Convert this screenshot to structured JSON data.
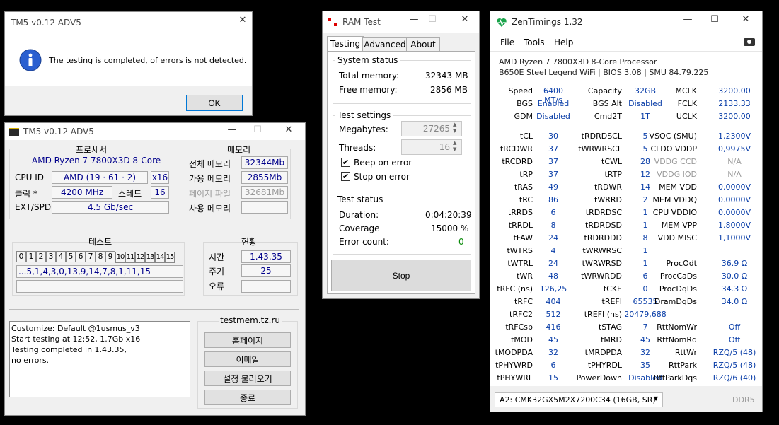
{
  "dialog": {
    "title": "TM5 v0.12 ADV5",
    "message": "The testing is completed, of errors is not detected.",
    "ok_label": "OK",
    "close": "✕"
  },
  "tm5": {
    "title": "TM5 v0.12 ADV5",
    "processor_header": "프로세서",
    "cpu_name": "AMD Ryzen 7 7800X3D 8-Core",
    "cpu_id_label": "CPU ID",
    "cpu_id_value": "AMD  (19 · 61 · 2)",
    "threads_x": "x16",
    "clock_label": "클럭 *",
    "clock_value": "4200 MHz",
    "threads_label": "스레드",
    "threads_value": "16",
    "ext_label": "EXT/SPD",
    "ext_value": "4.5 Gb/sec",
    "memory_header": "메모리",
    "mem_total_label": "전체 메모리",
    "mem_total_value": "32344Mb",
    "mem_avail_label": "가용 메모리",
    "mem_avail_value": "2855Mb",
    "mem_page_label": "페이지 파일",
    "mem_page_value": "32681Mb",
    "mem_used_label": "사용 메모리",
    "mem_used_value": "",
    "test_header": "테스트",
    "test_cells": [
      "0",
      "1",
      "2",
      "3",
      "4",
      "5",
      "6",
      "7",
      "8",
      "9",
      "10",
      "11",
      "12",
      "13",
      "14",
      "15"
    ],
    "test_sequence": "...5,1,4,3,0,13,9,14,7,8,1,11,15",
    "status_header": "현황",
    "time_label": "시간",
    "time_value": "1.43.35",
    "cycle_label": "주기",
    "cycle_value": "25",
    "error_label": "오류",
    "error_value": "",
    "site": "testmem.tz.ru",
    "log": [
      "Customize: Default @1usmus_v3",
      "Start testing at 12:52, 1.7Gb x16",
      "Testing completed in 1.43.35,",
      "no errors."
    ],
    "btn_home": "홈페이지",
    "btn_email": "이메일",
    "btn_load": "설정 불러오기",
    "btn_exit": "종료"
  },
  "ramtest": {
    "title": "RAM Test",
    "tabs": [
      "Testing",
      "Advanced",
      "About"
    ],
    "system_status": "System status",
    "total_mem_label": "Total memory:",
    "total_mem_value": "32343 MB",
    "free_mem_label": "Free memory:",
    "free_mem_value": "2856 MB",
    "test_settings": "Test settings",
    "megabytes_label": "Megabytes:",
    "megabytes_value": "27265",
    "threads_label": "Threads:",
    "threads_value": "16",
    "beep_label": "Beep on error",
    "stop_label": "Stop on error",
    "test_status": "Test status",
    "duration_label": "Duration:",
    "duration_value": "0:04:20:39",
    "coverage_label": "Coverage",
    "coverage_value": "15000 %",
    "errors_label": "Error count:",
    "errors_value": "0",
    "stop_button": "Stop"
  },
  "zen": {
    "title": "ZenTimings 1.32",
    "menu": [
      "File",
      "Tools",
      "Help"
    ],
    "cpu": "AMD Ryzen 7 7800X3D 8-Core Processor",
    "board": "B650E Steel Legend WiFi | BIOS 3.08 | SMU 84.79.225",
    "top": [
      [
        [
          "Speed",
          "6400 MT/s"
        ],
        [
          "Capacity",
          "32GB"
        ],
        [
          "MCLK",
          "3200.00"
        ]
      ],
      [
        [
          "BGS",
          "Enabled"
        ],
        [
          "BGS Alt",
          "Disabled"
        ],
        [
          "FCLK",
          "2133.33"
        ]
      ],
      [
        [
          "GDM",
          "Disabled"
        ],
        [
          "Cmd2T",
          "1T"
        ],
        [
          "UCLK",
          "3200.00"
        ]
      ]
    ],
    "rows": [
      [
        [
          "tCL",
          "30"
        ],
        [
          "tRDRDSCL",
          "5"
        ],
        [
          "VSOC (SMU)",
          "1,2300V"
        ]
      ],
      [
        [
          "tRCDWR",
          "37"
        ],
        [
          "tWRWRSCL",
          "5"
        ],
        [
          "CLDO VDDP",
          "0,9975V"
        ]
      ],
      [
        [
          "tRCDRD",
          "37"
        ],
        [
          "tCWL",
          "28"
        ],
        [
          "VDDG CCD",
          "N/A"
        ]
      ],
      [
        [
          "tRP",
          "37"
        ],
        [
          "tRTP",
          "12"
        ],
        [
          "VDDG IOD",
          "N/A"
        ]
      ],
      [
        [
          "tRAS",
          "49"
        ],
        [
          "tRDWR",
          "14"
        ],
        [
          "MEM VDD",
          "0.0000V"
        ]
      ],
      [
        [
          "tRC",
          "86"
        ],
        [
          "tWRRD",
          "2"
        ],
        [
          "MEM VDDQ",
          "0.0000V"
        ]
      ],
      [
        [
          "tRRDS",
          "6"
        ],
        [
          "tRDRDSC",
          "1"
        ],
        [
          "CPU VDDIO",
          "0.0000V"
        ]
      ],
      [
        [
          "tRRDL",
          "8"
        ],
        [
          "tRDRDSD",
          "1"
        ],
        [
          "MEM VPP",
          "1.8000V"
        ]
      ],
      [
        [
          "tFAW",
          "24"
        ],
        [
          "tRDRDDD",
          "8"
        ],
        [
          "VDD MISC",
          "1,1000V"
        ]
      ],
      [
        [
          "tWTRS",
          "4"
        ],
        [
          "tWRWRSC",
          "1"
        ],
        [
          "",
          ""
        ]
      ],
      [
        [
          "tWTRL",
          "24"
        ],
        [
          "tWRWRSD",
          "1"
        ],
        [
          "ProcOdt",
          "36.9 Ω"
        ]
      ],
      [
        [
          "tWR",
          "48"
        ],
        [
          "tWRWRDD",
          "6"
        ],
        [
          "ProcCaDs",
          "30.0 Ω"
        ]
      ],
      [
        [
          "tRFC (ns)",
          "126,25"
        ],
        [
          "tCKE",
          "0"
        ],
        [
          "ProcDqDs",
          "34.3 Ω"
        ]
      ],
      [
        [
          "tRFC",
          "404"
        ],
        [
          "tREFI",
          "65535"
        ],
        [
          "DramDqDs",
          "34.0 Ω"
        ]
      ],
      [
        [
          "tRFC2",
          "512"
        ],
        [
          "tREFI (ns)",
          "20479,688"
        ],
        [
          "",
          ""
        ]
      ],
      [
        [
          "tRFCsb",
          "416"
        ],
        [
          "tSTAG",
          "7"
        ],
        [
          "RttNomWr",
          "Off"
        ]
      ],
      [
        [
          "tMOD",
          "45"
        ],
        [
          "tMRD",
          "45"
        ],
        [
          "RttNomRd",
          "Off"
        ]
      ],
      [
        [
          "tMODPDA",
          "32"
        ],
        [
          "tMRDPDA",
          "32"
        ],
        [
          "RttWr",
          "RZQ/5 (48)"
        ]
      ],
      [
        [
          "tPHYWRD",
          "6"
        ],
        [
          "tPHYRDL",
          "35"
        ],
        [
          "RttPark",
          "RZQ/5 (48)"
        ]
      ],
      [
        [
          "tPHYWRL",
          "15"
        ],
        [
          "PowerDown",
          "Disabled"
        ],
        [
          "RttParkDqs",
          "RZQ/6 (40)"
        ]
      ]
    ],
    "dimm": "A2: CMK32GX5M2X7200C34 (16GB, SR)",
    "ddr": "DDR5",
    "colors": {
      "value": "#0a3ea8",
      "dim": "#9a9a9a"
    }
  }
}
